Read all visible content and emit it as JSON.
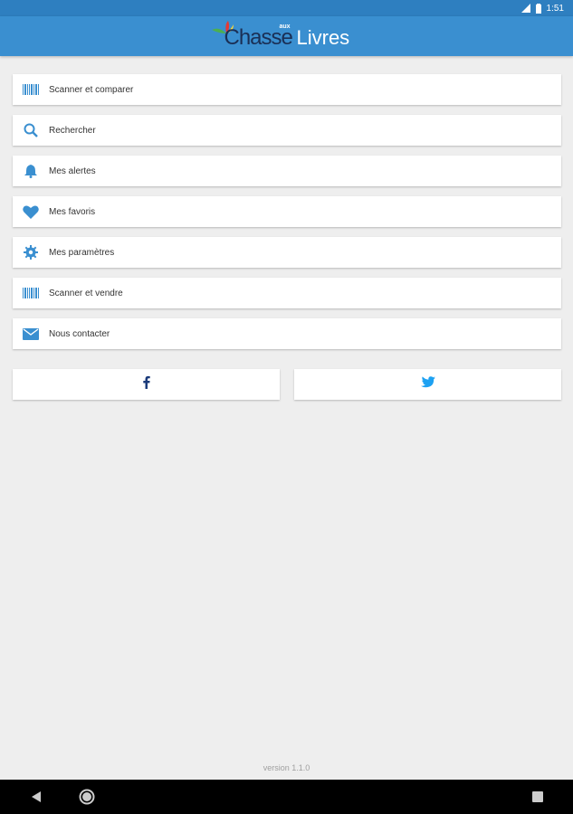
{
  "status_bar": {
    "time": "1:51"
  },
  "app_bar": {
    "logo": {
      "chasse": "Chasse",
      "aux": "aux",
      "livres": "Livres"
    },
    "color": "#3a8fd0"
  },
  "menu": {
    "items": [
      {
        "label": "Scanner et comparer",
        "icon": "barcode-icon"
      },
      {
        "label": "Rechercher",
        "icon": "search-icon"
      },
      {
        "label": "Mes alertes",
        "icon": "bell-icon"
      },
      {
        "label": "Mes favoris",
        "icon": "heart-icon"
      },
      {
        "label": "Mes paramètres",
        "icon": "gear-icon"
      },
      {
        "label": "Scanner et vendre",
        "icon": "barcode-icon"
      },
      {
        "label": "Nous contacter",
        "icon": "envelope-icon"
      }
    ],
    "icon_color": "#3a8fd0"
  },
  "social": {
    "facebook": {
      "icon": "facebook-icon",
      "color": "#1a3a7a"
    },
    "twitter": {
      "icon": "twitter-icon",
      "color": "#1da1f2"
    }
  },
  "footer": {
    "version": "version 1.1.0"
  }
}
